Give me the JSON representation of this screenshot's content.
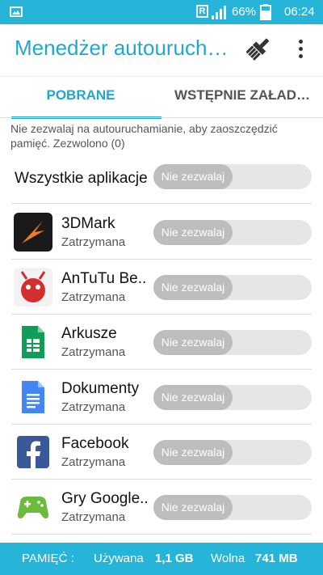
{
  "status_bar": {
    "r_badge": "R",
    "battery_percent": "66%",
    "time": "06:24"
  },
  "app_bar": {
    "title": "Menedżer autouruchamiania",
    "icons": [
      "broom-icon",
      "more-vert-icon"
    ]
  },
  "tabs": [
    {
      "label": "POBRANE",
      "active": true
    },
    {
      "label": "WSTĘPNIE ZAŁADOWANE",
      "active": false
    }
  ],
  "description": "Nie zezwalaj na autouruchamianie, aby zaoszczędzić pamięć. Zezwolono (0)",
  "all_apps": {
    "label": "Wszystkie aplikacje",
    "toggle": "Nie zezwalaj"
  },
  "apps": [
    {
      "name": "3DMark",
      "status": "Zatrzymana",
      "toggle": "Nie zezwalaj",
      "icon": "3dmark-icon"
    },
    {
      "name": "AnTuTu Be..",
      "status": "Zatrzymana",
      "toggle": "Nie zezwalaj",
      "icon": "antutu-icon"
    },
    {
      "name": "Arkusze",
      "status": "Zatrzymana",
      "toggle": "Nie zezwalaj",
      "icon": "sheets-icon"
    },
    {
      "name": "Dokumenty",
      "status": "Zatrzymana",
      "toggle": "Nie zezwalaj",
      "icon": "docs-icon"
    },
    {
      "name": "Facebook",
      "status": "Zatrzymana",
      "toggle": "Nie zezwalaj",
      "icon": "facebook-icon"
    },
    {
      "name": "Gry Google..",
      "status": "Zatrzymana",
      "toggle": "Nie zezwalaj",
      "icon": "play-games-icon"
    }
  ],
  "footer": {
    "memory_label": "PAMIĘĆ :",
    "used_label": "Używana",
    "used_value": "1,1 GB",
    "free_label": "Wolna",
    "free_value": "741 MB"
  },
  "colors": {
    "accent": "#26b5d9",
    "title": "#1fa7cf",
    "toggle_knob": "#bdbdbd",
    "toggle_track": "#e6e6e6"
  }
}
